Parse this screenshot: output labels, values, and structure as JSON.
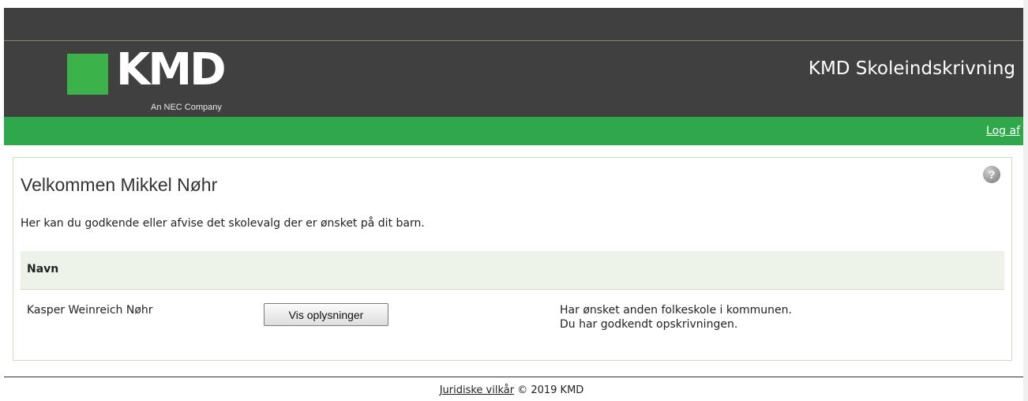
{
  "header": {
    "logo_text": "KMD",
    "logo_subtext": "An NEC Company",
    "app_title": "KMD Skoleindskrivning"
  },
  "nav": {
    "logout": "Log af"
  },
  "main": {
    "welcome": "Velkommen Mikkel Nøhr",
    "intro": "Her kan du godkende eller afvise det skolevalg der er ønsket på dit barn.",
    "table": {
      "columns": [
        "Navn"
      ],
      "rows": [
        {
          "name": "Kasper Weinreich Nøhr",
          "button": "Vis oplysninger",
          "status": [
            "Har ønsket anden folkeskole i kommunen.",
            "Du har godkendt opskrivningen."
          ]
        }
      ]
    }
  },
  "footer": {
    "link": "Juridiske vilkår",
    "copyright": " © 2019 KMD"
  },
  "colors": {
    "header_bg": "#404040",
    "brand_green": "#2ea84a",
    "table_header_bg": "#eef3e9"
  },
  "icons": {
    "help": "help-icon"
  }
}
